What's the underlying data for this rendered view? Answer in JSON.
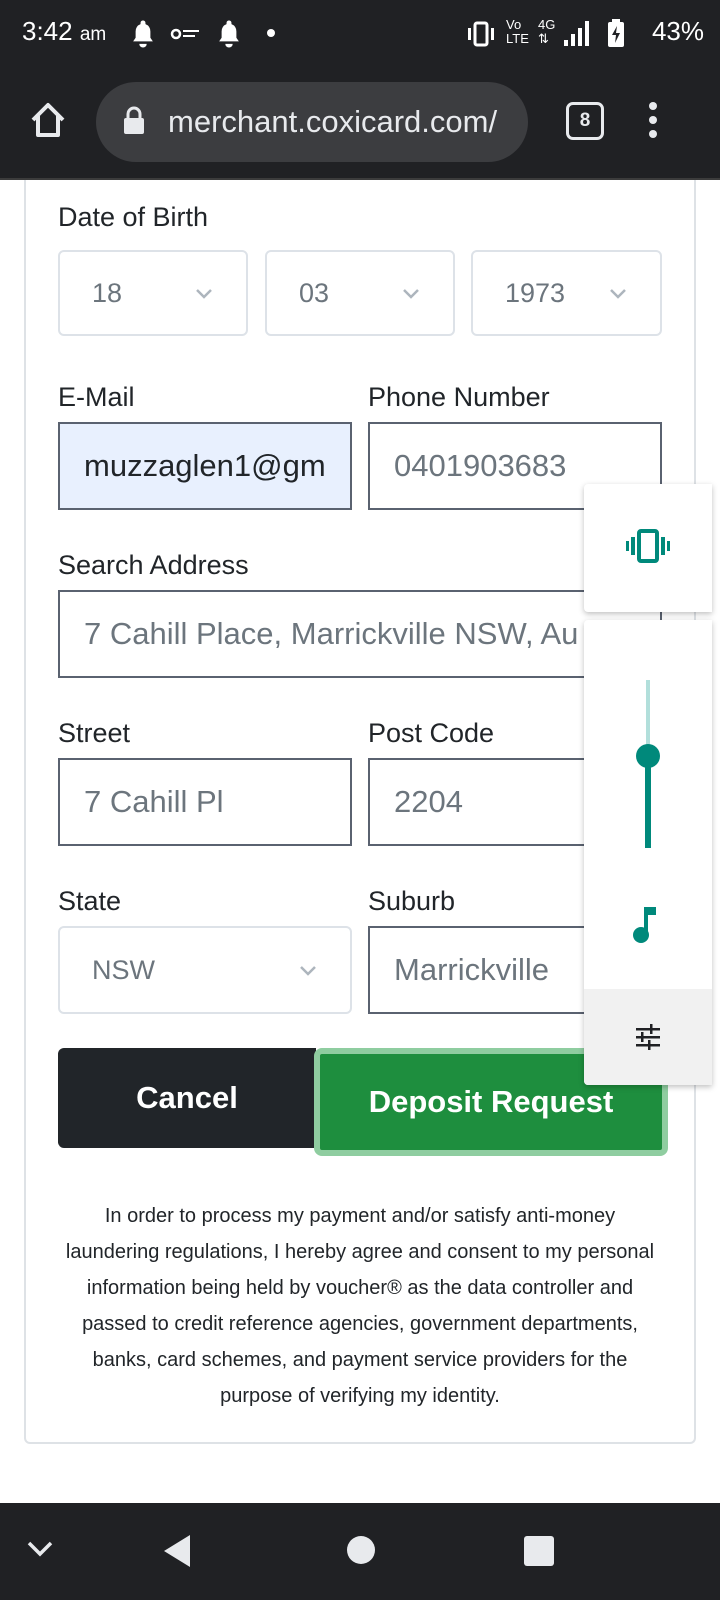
{
  "status_bar": {
    "time": "3:42",
    "ampm": "am",
    "battery": "43%",
    "network": {
      "vo": "Vo",
      "lte": "LTE",
      "gen": "4G"
    }
  },
  "browser": {
    "url": "merchant.coxicard.com/",
    "tab_count": "8"
  },
  "form": {
    "dob": {
      "label": "Date of Birth",
      "day": "18",
      "month": "03",
      "year": "1973"
    },
    "email": {
      "label": "E-Mail",
      "value": "muzzaglen1@gm"
    },
    "phone": {
      "label": "Phone Number",
      "value": "0401903683"
    },
    "search_address": {
      "label": "Search Address",
      "value": "7 Cahill Place, Marrickville NSW, Au"
    },
    "street": {
      "label": "Street",
      "value": "7 Cahill Pl"
    },
    "post_code": {
      "label": "Post Code",
      "value": "2204"
    },
    "state": {
      "label": "State",
      "value": "NSW"
    },
    "suburb": {
      "label": "Suburb",
      "value": "Marrickville"
    },
    "cancel_label": "Cancel",
    "deposit_label": "Deposit Request",
    "consent_text": "In order to process my payment and/or satisfy anti-money laundering regulations, I hereby agree and consent to my personal information being held by voucher® as the data controller and passed to credit reference agencies, government departments, banks, card schemes, and payment service providers for the purpose of verifying my identity."
  },
  "volume_panel": {
    "level": 0.55,
    "accent": "#00897b"
  }
}
